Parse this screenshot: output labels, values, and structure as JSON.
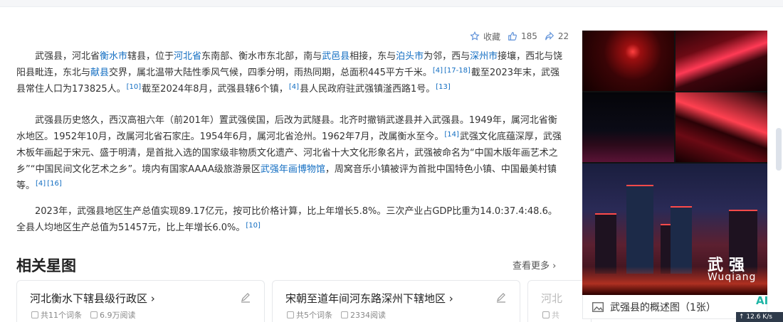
{
  "actions": {
    "collect_label": "收藏",
    "like_count": "185",
    "share_count": "22"
  },
  "paragraph1": {
    "t1": "武强县，河北省",
    "l1": "衡水市",
    "t2": "辖县，位于",
    "l2": "河北省",
    "t3": "东南部、衡水市东北部，南与",
    "l3": "武邑县",
    "t4": "相接，东与",
    "l4": "泊头市",
    "t5": "为邻，西与",
    "l5": "深州市",
    "t6": "接壤，西北与饶阳县毗连，东北与",
    "l6": "献县",
    "t7": "交界，属北温带大陆性季风气候，四季分明，雨热同期，总面积445平方千米。",
    "r1": "[4]",
    "r2": "[17-18]",
    "t8": "截至2023年末，武强县常住人口为173825人。",
    "r3": "[10]",
    "t9": "截至2024年8月，武强县辖6个镇，",
    "r4": "[4]",
    "t10": "县人民政府驻武强镇滏西路1号。",
    "r5": "[13]"
  },
  "paragraph2": {
    "t1": "武强县历史悠久，西汉高祖六年（前201年）置武强侯国，后改为武隧县。北齐时撤销武遂县并入武强县。1949年，属河北省衡水地区。1952年10月，改属河北省石家庄。1954年6月，属河北省沧州。1962年7月，改属衡水至今。",
    "r1": "[14]",
    "t2": "武强文化底蕴深厚，武强木板年画起于宋元、盛于明清，是首批入选的国家级非物质文化遗产、河北省十大文化形象名片，武强被命名为“中国木版年画艺术之乡”“中国民间文化艺术之乡”。境内有国家AAAA级旅游景区",
    "l1": "武强年画博物馆",
    "t3": "，周窝音乐小镇被评为首批中国特色小镇、中国最美村镇等。",
    "r2": "[4]",
    "r3": "[16]"
  },
  "paragraph3": {
    "t1": "2023年，武强县地区生产总值实现89.17亿元，按可比价格计算，比上年增长5.8%。三次产业占GDP比重为14.0:37.4:48.6。全县人均地区生产总值为51457元，比上年增长6.0%。",
    "r1": "[10]"
  },
  "related": {
    "title": "相关星图",
    "see_more": "查看更多",
    "cards": [
      {
        "title": "河北衡水下辖县级行政区",
        "words": "共11个词条",
        "reads": "6.9万阅读"
      },
      {
        "title": "宋朝至道年间河东路深州下辖地区",
        "words": "共5个词条",
        "reads": "2334阅读"
      },
      {
        "title": "河北",
        "words": "共"
      }
    ]
  },
  "gallery": {
    "overlay_cn": "武强",
    "overlay_en": "Wuqiang",
    "caption": "武强县的概述图（1张）"
  },
  "widgets": {
    "ai_badge": "AI",
    "net_speed": "↑ 12.6 K/s"
  },
  "colors": {
    "link": "#136ec2",
    "text": "#333333"
  }
}
